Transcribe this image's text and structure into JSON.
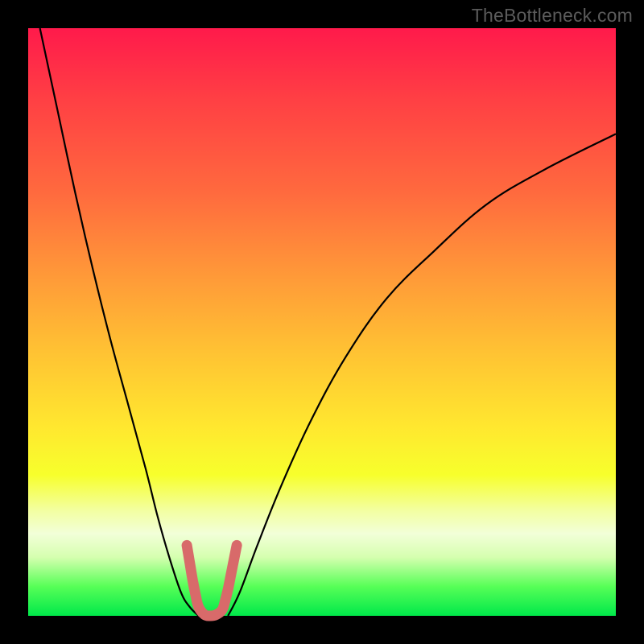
{
  "attribution": "TheBottleneck.com",
  "chart_data": {
    "type": "line",
    "title": "",
    "xlabel": "",
    "ylabel": "",
    "xlim": [
      0,
      100
    ],
    "ylim": [
      0,
      100
    ],
    "grid": false,
    "legend": false,
    "series": [
      {
        "name": "left-curve",
        "color": "#000000",
        "x": [
          2,
          5,
          8,
          11,
          14,
          17,
          20,
          22,
          24,
          26,
          27.5,
          29
        ],
        "y": [
          100,
          86,
          72,
          59,
          47,
          36,
          25,
          17,
          10,
          4,
          1.5,
          0
        ]
      },
      {
        "name": "right-curve",
        "color": "#000000",
        "x": [
          34,
          36,
          39,
          43,
          48,
          54,
          61,
          69,
          78,
          88,
          100
        ],
        "y": [
          0,
          4,
          12,
          22,
          33,
          44,
          54,
          62,
          70,
          76,
          82
        ]
      },
      {
        "name": "trough-marker",
        "color": "#d86a6a",
        "x": [
          27,
          27.5,
          28,
          28.5,
          29,
          30,
          31,
          32,
          33,
          33.5,
          34,
          34.5,
          35,
          35.5
        ],
        "y": [
          12,
          9,
          6,
          3.5,
          1.5,
          0.2,
          0,
          0.2,
          1,
          2.5,
          4.5,
          7,
          9.5,
          12
        ]
      }
    ]
  },
  "colors": {
    "frame": "#000000",
    "curve": "#000000",
    "trough": "#d86a6a"
  }
}
